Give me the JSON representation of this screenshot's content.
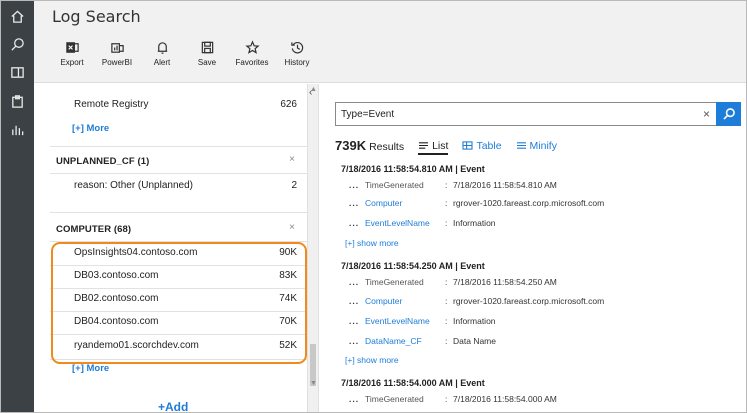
{
  "app": {
    "title": "Log Search"
  },
  "rail": [
    {
      "icon": "home-icon"
    },
    {
      "icon": "search-icon"
    },
    {
      "icon": "layout-icon"
    },
    {
      "icon": "clipboard-icon"
    },
    {
      "icon": "bar-chart-icon"
    }
  ],
  "toolbar": {
    "export": "Export",
    "powerbi": "PowerBI",
    "alert": "Alert",
    "save": "Save",
    "favorites": "Favorites",
    "history": "History"
  },
  "left": {
    "top_item": {
      "name": "Remote Registry",
      "count": "626"
    },
    "more": "[+] More",
    "groups": [
      {
        "title": "UNPLANNED_CF  (1)",
        "items": [
          {
            "name": "reason: Other (Unplanned)",
            "count": "2"
          }
        ]
      },
      {
        "title": "COMPUTER  (68)",
        "items": [
          {
            "name": "OpsInsights04.contoso.com",
            "count": "90K"
          },
          {
            "name": "DB03.contoso.com",
            "count": "83K"
          },
          {
            "name": "DB02.contoso.com",
            "count": "74K"
          },
          {
            "name": "DB04.contoso.com",
            "count": "70K"
          },
          {
            "name": "ryandemo01.scorchdev.com",
            "count": "52K"
          }
        ],
        "more": "[+] More"
      }
    ],
    "close": "×",
    "add": "+Add",
    "collapse": "‹"
  },
  "right": {
    "search": {
      "value": "Type=Event",
      "clear": "×"
    },
    "results": {
      "count": "739K",
      "label": "Results"
    },
    "views": {
      "list": "List",
      "table": "Table",
      "minify": "Minify"
    },
    "events": [
      {
        "header": "7/18/2016 11:58:54.810 AM | Event",
        "fields": [
          {
            "k": "TimeGenerated",
            "v": "7/18/2016 11:58:54.810 AM",
            "link": false
          },
          {
            "k": "Computer",
            "v": "rgrover-1020.fareast.corp.microsoft.com",
            "link": true
          },
          {
            "k": "EventLevelName",
            "v": "Information",
            "link": true
          }
        ],
        "show_more": "[+] show more"
      },
      {
        "header": "7/18/2016 11:58:54.250 AM | Event",
        "fields": [
          {
            "k": "TimeGenerated",
            "v": "7/18/2016 11:58:54.250 AM",
            "link": false
          },
          {
            "k": "Computer",
            "v": "rgrover-1020.fareast.corp.microsoft.com",
            "link": true
          },
          {
            "k": "EventLevelName",
            "v": "Information",
            "link": true
          },
          {
            "k": "DataName_CF",
            "v": "Data Name",
            "link": true
          }
        ],
        "show_more": "[+] show more"
      },
      {
        "header": "7/18/2016 11:58:54.000 AM | Event",
        "fields": [
          {
            "k": "TimeGenerated",
            "v": "7/18/2016 11:58:54.000 AM",
            "link": false
          }
        ]
      }
    ],
    "dots": "...",
    "colon": ":"
  },
  "colors": {
    "accent": "#1e7dd8",
    "highlight": "#f08a1c",
    "rail": "#3c4146"
  }
}
